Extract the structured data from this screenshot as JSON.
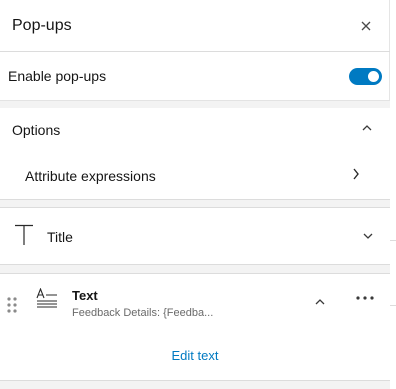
{
  "panel": {
    "title": "Pop-ups",
    "close_icon": "close-icon"
  },
  "enable": {
    "label": "Enable pop-ups",
    "toggle_on": true,
    "accent": "#007ac2"
  },
  "options": {
    "title": "Options",
    "expanded": true,
    "attribute_expressions": "Attribute expressions"
  },
  "title_element": {
    "label": "Title",
    "icon": "title-text-icon"
  },
  "text_element": {
    "label": "Text",
    "description": "Feedback Details: {Feedba...",
    "icon": "text-paragraph-icon",
    "edit_label": "Edit text"
  }
}
